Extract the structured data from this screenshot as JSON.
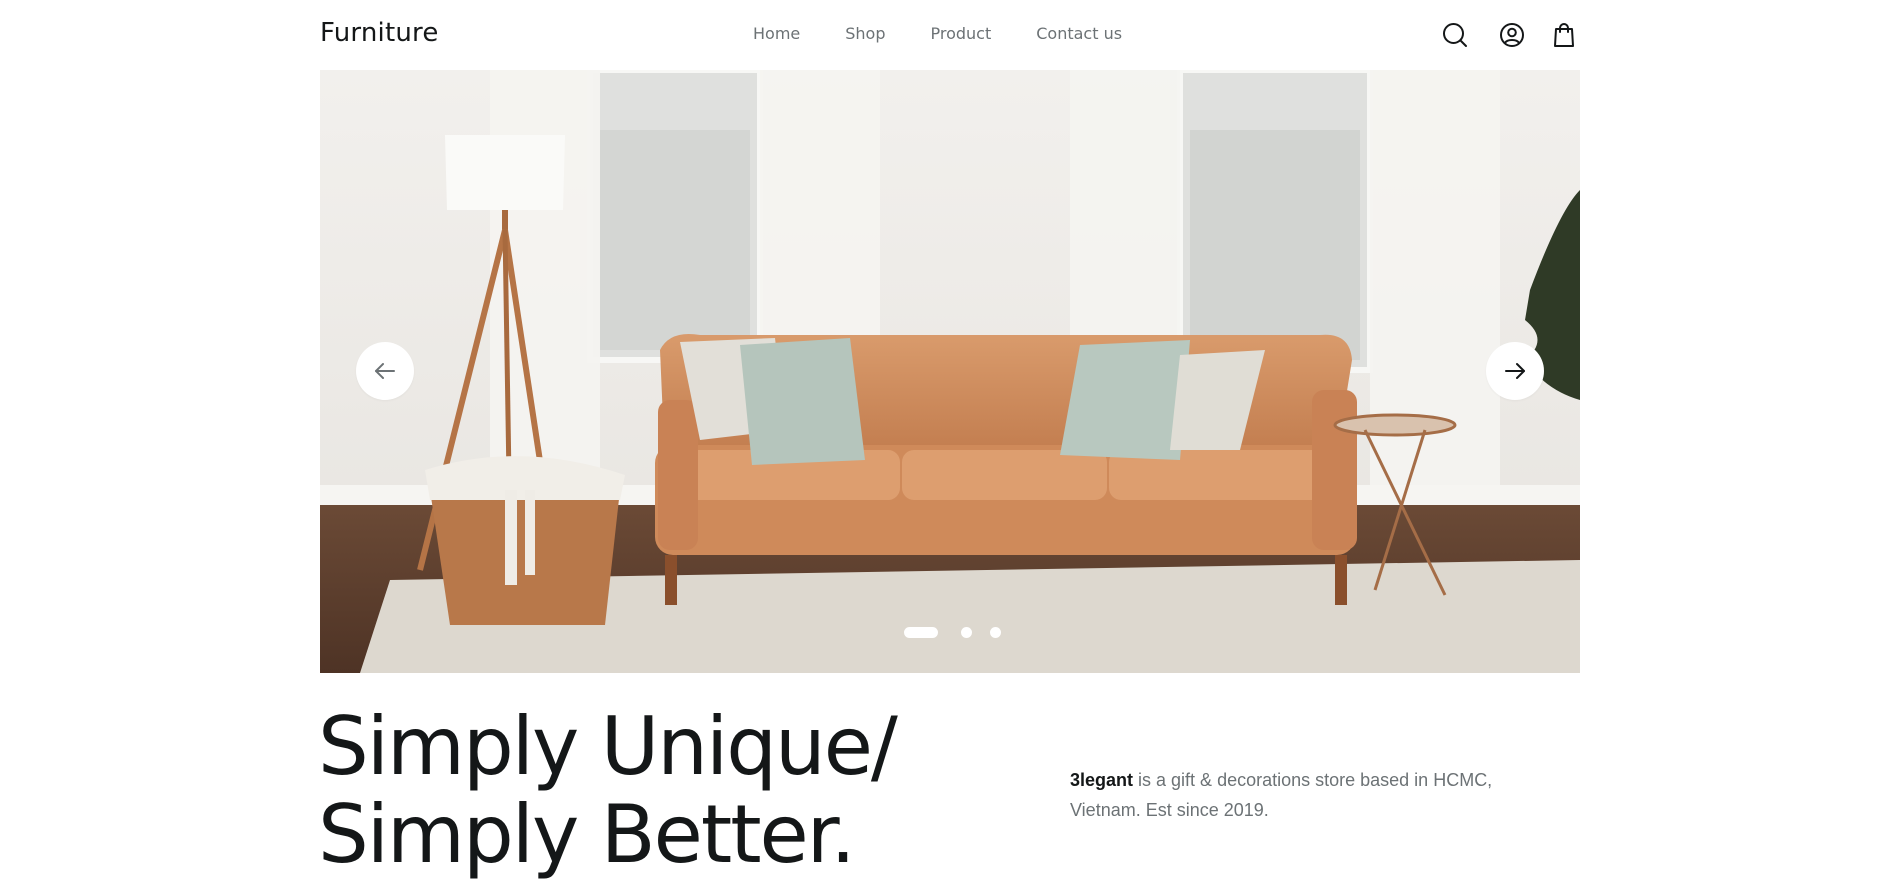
{
  "nav": {
    "logo": "Furniture",
    "links": [
      "Home",
      "Shop",
      "Product",
      "Contact us"
    ],
    "icons": [
      "search-icon",
      "user-icon",
      "shopping-bag-icon"
    ]
  },
  "hero": {
    "carousel": {
      "slide_count": 3,
      "active_slide": 1,
      "prev_icon": "arrow-left-icon",
      "next_icon": "arrow-right-icon"
    }
  },
  "intro": {
    "headline_line1": "Simply Unique/",
    "headline_line2": "Simply Better.",
    "brand": "3legant",
    "description_line1": " is a gift & decorations store based in HCMC,",
    "description_line2": "Vietnam. Est since 2019."
  },
  "colors": {
    "text_primary": "#141718",
    "text_secondary": "#6c7275",
    "background": "#ffffff"
  }
}
